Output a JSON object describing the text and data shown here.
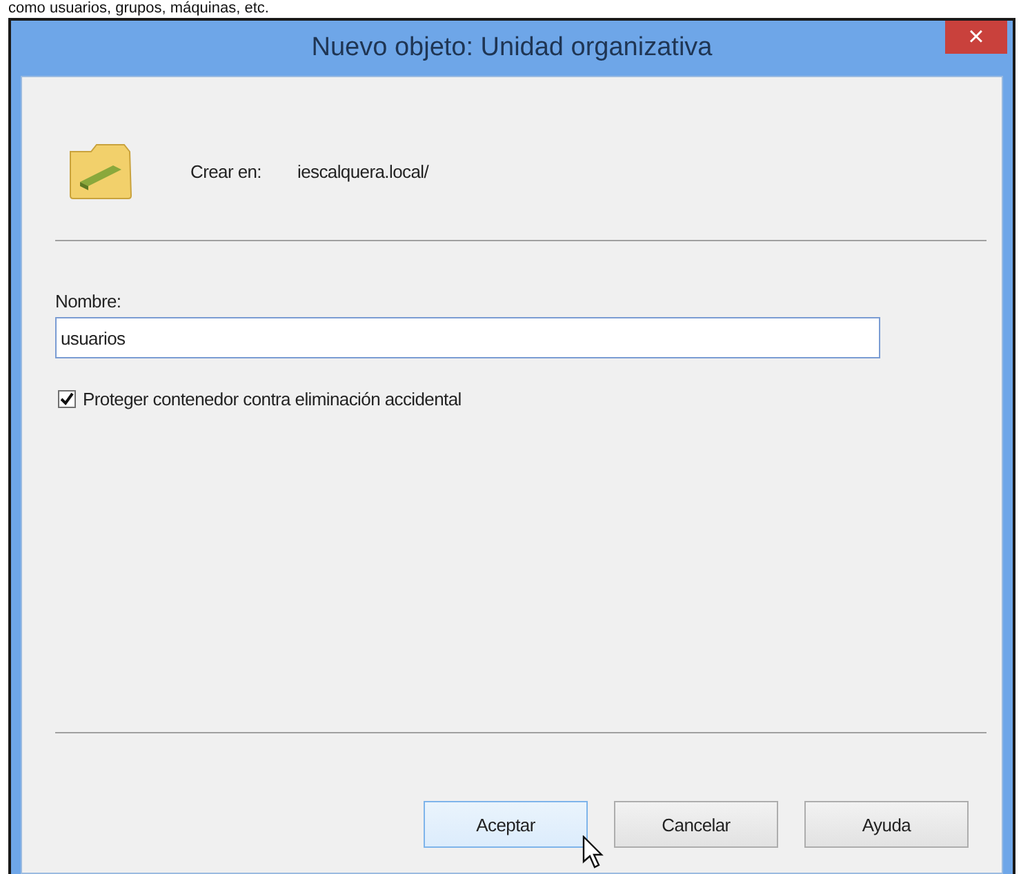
{
  "caption": "como usuarios, grupos, máquinas, etc.",
  "window": {
    "title": "Nuevo objeto: Unidad organizativa",
    "close": "×"
  },
  "create_in": {
    "label": "Crear en:",
    "value": "iescalquera.local/"
  },
  "name_field": {
    "label": "Nombre:",
    "value": "usuarios"
  },
  "protect": {
    "label": "Proteger contenedor contra eliminación accidental",
    "checked": true
  },
  "buttons": [
    {
      "label": "Aceptar",
      "selected": true
    },
    {
      "label": "Cancelar",
      "selected": false
    },
    {
      "label": "Ayuda",
      "selected": false
    }
  ]
}
